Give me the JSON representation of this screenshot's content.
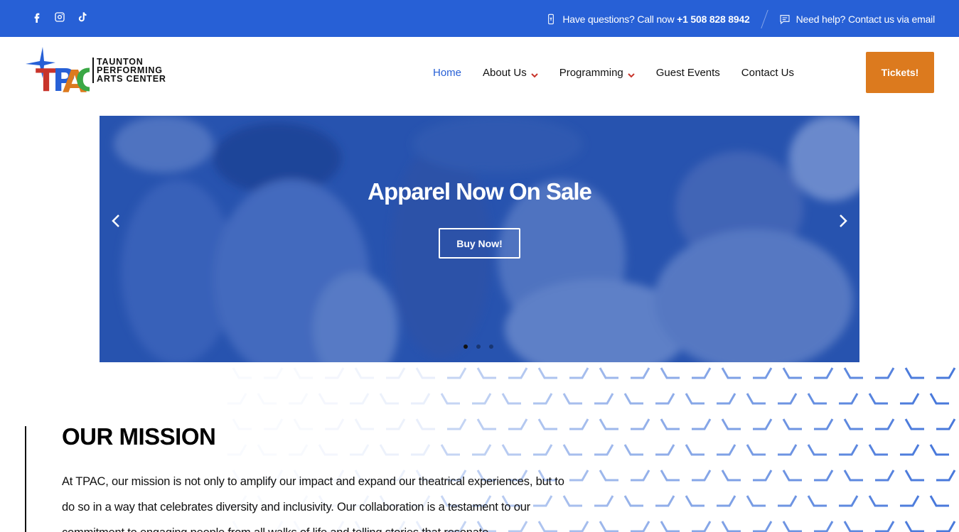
{
  "topbar": {
    "social": [
      "facebook-icon",
      "instagram-icon",
      "tiktok-icon"
    ],
    "call_text": "Have questions? Call now",
    "phone": "+1 508 828 8942",
    "help_text": "Need help? Contact us via email"
  },
  "logo": {
    "letters": "TPAC",
    "line1": "TAUNTON",
    "line2": "PERFORMING",
    "line3": "ARTS CENTER"
  },
  "nav": {
    "items": [
      {
        "label": "Home",
        "active": true
      },
      {
        "label": "About Us",
        "dropdown": true
      },
      {
        "label": "Programming",
        "dropdown": true
      },
      {
        "label": "Guest Events"
      },
      {
        "label": "Contact Us"
      }
    ],
    "tickets_label": "Tickets!"
  },
  "hero": {
    "title": "Apparel Now On Sale",
    "button": "Buy Now!",
    "slide_count": 3,
    "active_slide": 1
  },
  "mission": {
    "title": "OUR MISSION",
    "text": "At TPAC, our mission is not only to amplify our impact and expand our theatrical experiences, but to do so in a way that celebrates diversity and inclusivity. Our collaboration is a testament to our commitment to engaging people from all walks of life and telling stories that resonate"
  },
  "colors": {
    "brand_blue": "#2760d6",
    "tickets_orange": "#dc7a1e",
    "hero_overlay": "#2a56b0"
  }
}
